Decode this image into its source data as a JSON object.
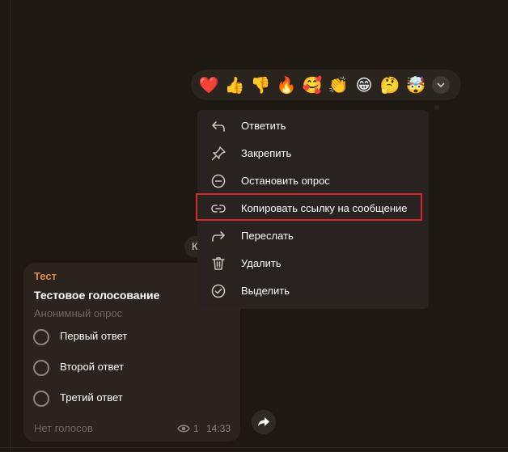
{
  "reactions": {
    "emojis": [
      {
        "name": "heart",
        "char": "❤️"
      },
      {
        "name": "thumbs-up",
        "char": "👍"
      },
      {
        "name": "thumbs-down",
        "char": "👎"
      },
      {
        "name": "fire",
        "char": "🔥"
      },
      {
        "name": "smiling-hearts",
        "char": "🥰"
      },
      {
        "name": "clapping",
        "char": "👏"
      },
      {
        "name": "grinning",
        "char": "😁"
      },
      {
        "name": "thinking",
        "char": "🤔"
      },
      {
        "name": "exploding-head",
        "char": "🤯"
      }
    ]
  },
  "menu": {
    "items": [
      {
        "label": "Ответить",
        "icon": "reply-icon"
      },
      {
        "label": "Закрепить",
        "icon": "pin-icon"
      },
      {
        "label": "Остановить опрос",
        "icon": "stop-icon"
      },
      {
        "label": "Копировать ссылку на сообщение",
        "icon": "link-icon"
      },
      {
        "label": "Переслать",
        "icon": "forward-icon"
      },
      {
        "label": "Удалить",
        "icon": "trash-icon"
      },
      {
        "label": "Выделить",
        "icon": "check-circle-icon"
      }
    ]
  },
  "date_chip": "К",
  "message": {
    "sender": "Тест",
    "poll_question": "Тестовое голосование",
    "poll_type": "Анонимный опрос",
    "options": [
      "Первый ответ",
      "Второй ответ",
      "Третий ответ"
    ],
    "votes": "Нет голосов",
    "views": "1",
    "time": "14:33"
  },
  "colors": {
    "background": "#1e1813",
    "bubble": "#2b241e",
    "menu": "#282320",
    "sender": "#e08a50",
    "highlight": "#d9262a"
  }
}
